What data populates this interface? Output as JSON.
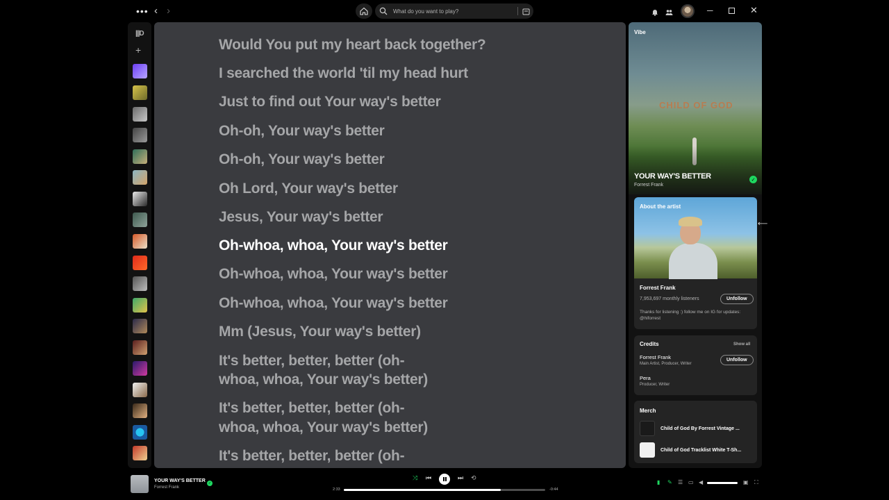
{
  "topbar": {
    "search_placeholder": "What do you want to play?"
  },
  "lyrics": {
    "lines": [
      "Would You put my heart back together?",
      "I searched the world 'til my head hurt",
      "Just to find out Your way's better",
      "Oh-oh, Your way's better",
      "Oh-oh, Your way's better",
      "Oh Lord, Your way's better",
      "Jesus, Your way's better",
      "Oh-whoa, whoa, Your way's better",
      "Oh-whoa, whoa, Your way's better",
      "Oh-whoa, whoa, Your way's better",
      "Mm (Jesus, Your way's better)",
      "It's better, better, better (oh-",
      "whoa, whoa, Your way's better)",
      "It's better, better, better (oh-",
      "whoa, whoa, Your way's better)",
      "It's better, better, better (oh-"
    ],
    "active_index": 7
  },
  "right_panel": {
    "section_label": "Vibe",
    "art_text": "CHILD OF GOD",
    "song_title": "YOUR WAY'S BETTER",
    "song_artist": "Forrest Frank",
    "about": {
      "label": "About the artist",
      "name": "Forrest Frank",
      "listeners": "7,953,697 monthly listeners",
      "follow_label": "Unfollow",
      "bio": "Thanks for listening :) follow me on IG for updates: @hiforrest"
    },
    "credits": {
      "title": "Credits",
      "show_all": "Show all",
      "people": [
        {
          "name": "Forrest Frank",
          "role": "Main Artist, Producer, Writer",
          "follow_label": "Unfollow"
        },
        {
          "name": "Pera",
          "role": "Producer, Writer"
        }
      ]
    },
    "merch": {
      "title": "Merch",
      "items": [
        "Child of God By Forrest Vintage ...",
        "Child of God Tracklist White T-Sh..."
      ]
    }
  },
  "now_playing": {
    "title": "YOUR WAY'S BETTER",
    "artist": "Forrest Frank",
    "elapsed": "2:33",
    "remaining": "-0:44",
    "progress_fraction": 0.78,
    "volume_fraction": 1.0
  },
  "colors": {
    "accent_green": "#1ed760",
    "lyrics_bg": "#3a3b3f",
    "lyric_inactive": "#a5a6a8",
    "lyric_active": "#ffffff"
  }
}
